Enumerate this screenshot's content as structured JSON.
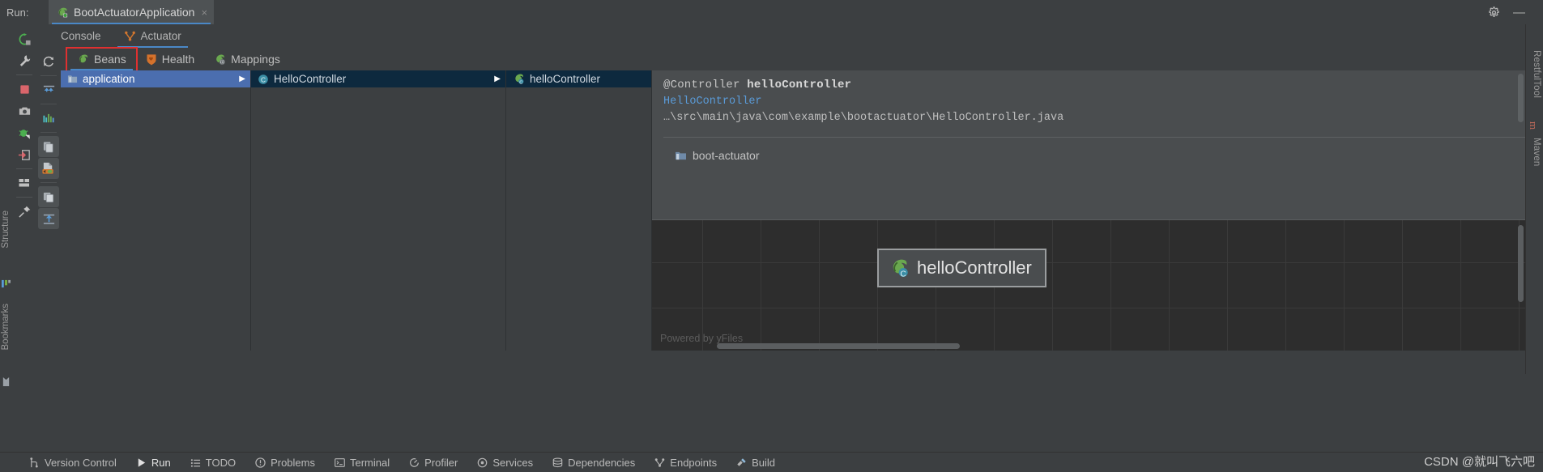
{
  "window": {
    "run_label": "Run:",
    "tab_title": "BootActuatorApplication",
    "tab_close": "×",
    "settings_icon": "gear-icon",
    "minimize_icon": "minimize-icon",
    "minimize_glyph": "—"
  },
  "left_toolbar": [
    {
      "name": "rerun-button",
      "icon": "rerun-icon"
    },
    {
      "name": "edit-configuration-button",
      "icon": "wrench-icon"
    },
    {
      "name": "stop-button",
      "icon": "stop-square-icon"
    },
    {
      "name": "screenshot-button",
      "icon": "camera-icon"
    },
    {
      "name": "attach-debugger-button",
      "icon": "bug-attach-icon"
    },
    {
      "name": "open-in-browser-button",
      "icon": "export-arrow-icon"
    },
    {
      "name": "layout-button",
      "icon": "layout-icon"
    },
    {
      "name": "pin-tab-button",
      "icon": "pin-icon"
    }
  ],
  "sub_tabs": [
    {
      "label": "Console",
      "icon": "console-icon",
      "active": false
    },
    {
      "label": "Actuator",
      "icon": "actuator-icon",
      "active": true
    }
  ],
  "inner_toolbar": [
    {
      "name": "refresh-button",
      "icon": "refresh-icon",
      "pressed": false
    },
    {
      "name": "collapse-all-button",
      "icon": "collapse-all-icon",
      "pressed": false
    },
    {
      "name": "metrics-button",
      "icon": "bar-chart-icon",
      "pressed": false
    },
    {
      "name": "show-beans-button",
      "icon": "copy-beans-icon",
      "pressed": true
    },
    {
      "name": "show-library-beans-button",
      "icon": "library-beans-icon",
      "pressed": true
    },
    {
      "name": "show-diagram-button",
      "icon": "diagram-icon",
      "pressed": true
    },
    {
      "name": "fit-content-button",
      "icon": "fit-content-icon",
      "pressed": true
    }
  ],
  "endpoint_tabs": [
    {
      "label": "Beans",
      "icon": "spring-bean-icon",
      "active": true,
      "highlighted": true
    },
    {
      "label": "Health",
      "icon": "health-heart-icon",
      "active": false,
      "highlighted": false
    },
    {
      "label": "Mappings",
      "icon": "mappings-globe-icon",
      "active": false,
      "highlighted": false
    }
  ],
  "tree": {
    "column1": [
      {
        "label": "application",
        "icon": "module-icon",
        "state": "selected-active",
        "has_children": true
      }
    ],
    "column2": [
      {
        "label": "HelloController",
        "icon": "class-icon",
        "state": "selected-inactive",
        "has_children": true
      }
    ],
    "column3": [
      {
        "label": "helloController",
        "icon": "spring-bean-icon",
        "state": "selected-inactive",
        "has_children": false
      }
    ]
  },
  "detail": {
    "annotation": "@Controller",
    "bean_name": "helloController",
    "class_name": "HelloController",
    "file_path": "…\\src\\main\\java\\com\\example\\bootactuator\\HelloController.java",
    "module_label": "boot-actuator",
    "module_icon": "module-folder-icon"
  },
  "graph": {
    "node_label": "helloController",
    "node_icon": "spring-bean-icon",
    "credit": "Powered by yFiles"
  },
  "vertical_tabs_right": [
    {
      "label": "RestfulTool"
    },
    {
      "label": "Maven"
    }
  ],
  "vertical_tabs_left": [
    {
      "label": "Structure",
      "icon": "structure-icon"
    },
    {
      "label": "Bookmarks",
      "icon": "bookmarks-icon"
    }
  ],
  "status_bar": [
    {
      "label": "Version Control",
      "icon": "version-control-icon",
      "active": false
    },
    {
      "label": "Run",
      "icon": "run-play-icon",
      "active": true
    },
    {
      "label": "TODO",
      "icon": "todo-list-icon",
      "active": false
    },
    {
      "label": "Problems",
      "icon": "problems-icon",
      "active": false
    },
    {
      "label": "Terminal",
      "icon": "terminal-icon",
      "active": false
    },
    {
      "label": "Profiler",
      "icon": "profiler-icon",
      "active": false
    },
    {
      "label": "Services",
      "icon": "services-icon",
      "active": false
    },
    {
      "label": "Dependencies",
      "icon": "dependencies-icon",
      "active": false
    },
    {
      "label": "Endpoints",
      "icon": "endpoints-icon",
      "active": false
    },
    {
      "label": "Build",
      "icon": "build-hammer-icon",
      "active": false
    }
  ],
  "watermark": "CSDN @就叫飞六吧",
  "colors": {
    "accent_blue": "#4a88c7",
    "selection_active": "#4b6eaf",
    "selection_inactive": "#0d293e",
    "highlight_red": "#e03030",
    "spring_green": "#6aa84f",
    "panel_bg": "#3c3f41",
    "detail_bg": "#4a4d4f",
    "graph_bg": "#2d2d2d",
    "link_blue": "#5a9bd8"
  }
}
